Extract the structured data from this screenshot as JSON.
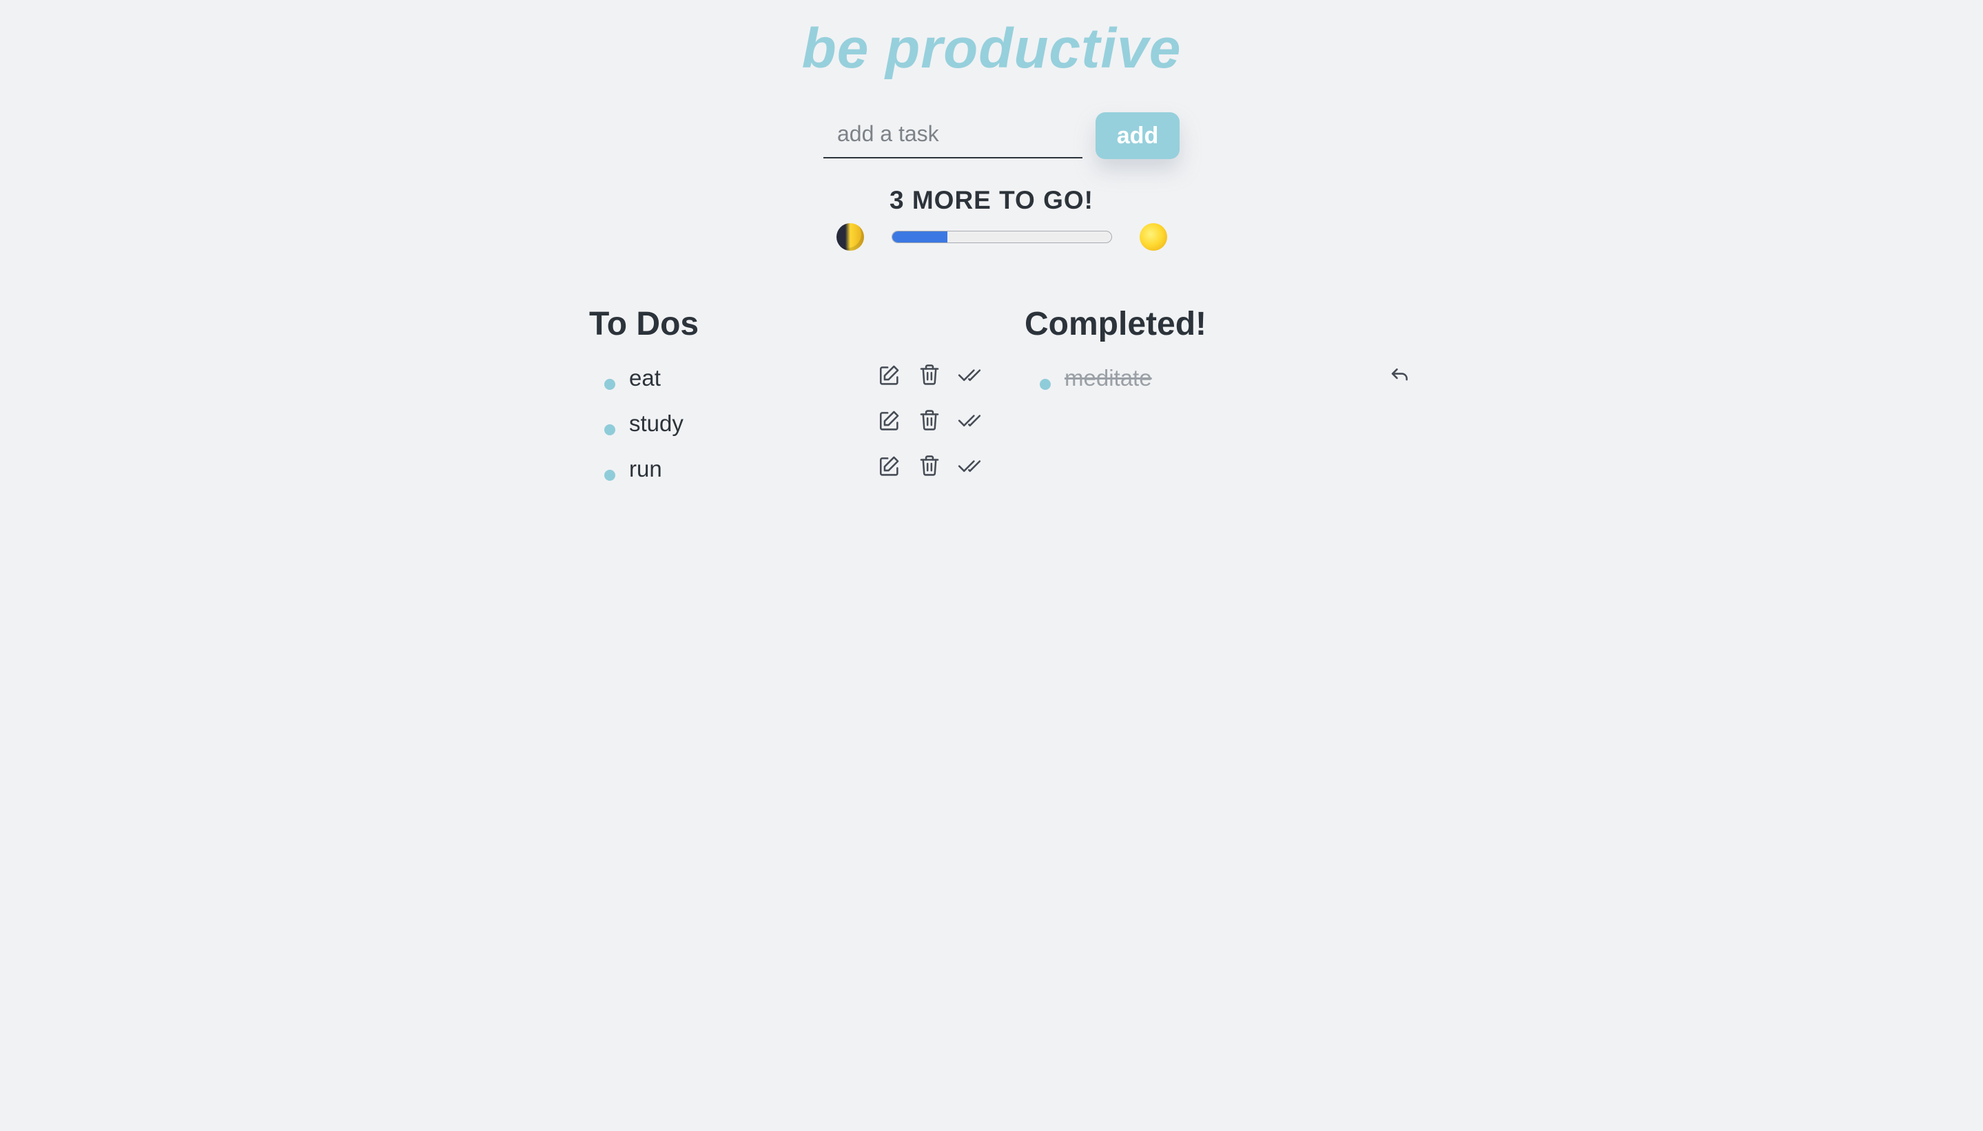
{
  "app": {
    "title": "be productive"
  },
  "task_form": {
    "input_placeholder": "add a task",
    "input_value": "",
    "add_label": "add"
  },
  "progress": {
    "status_text": "3 MORE TO GO!",
    "completed_fraction": 0.25,
    "start_icon": "moon-icon",
    "end_icon": "sun-icon",
    "fill_color": "#3c78e3"
  },
  "todos": {
    "title": "To Dos",
    "items": [
      {
        "label": "eat"
      },
      {
        "label": "study"
      },
      {
        "label": "run"
      }
    ],
    "item_actions": [
      "edit-icon",
      "trash-icon",
      "double-check-icon"
    ]
  },
  "completed": {
    "title": "Completed!",
    "items": [
      {
        "label": "meditate"
      }
    ],
    "item_action": "undo-icon"
  },
  "colors": {
    "background": "#f1f2f4",
    "accent": "#96d0dc",
    "text": "#2c333a"
  }
}
